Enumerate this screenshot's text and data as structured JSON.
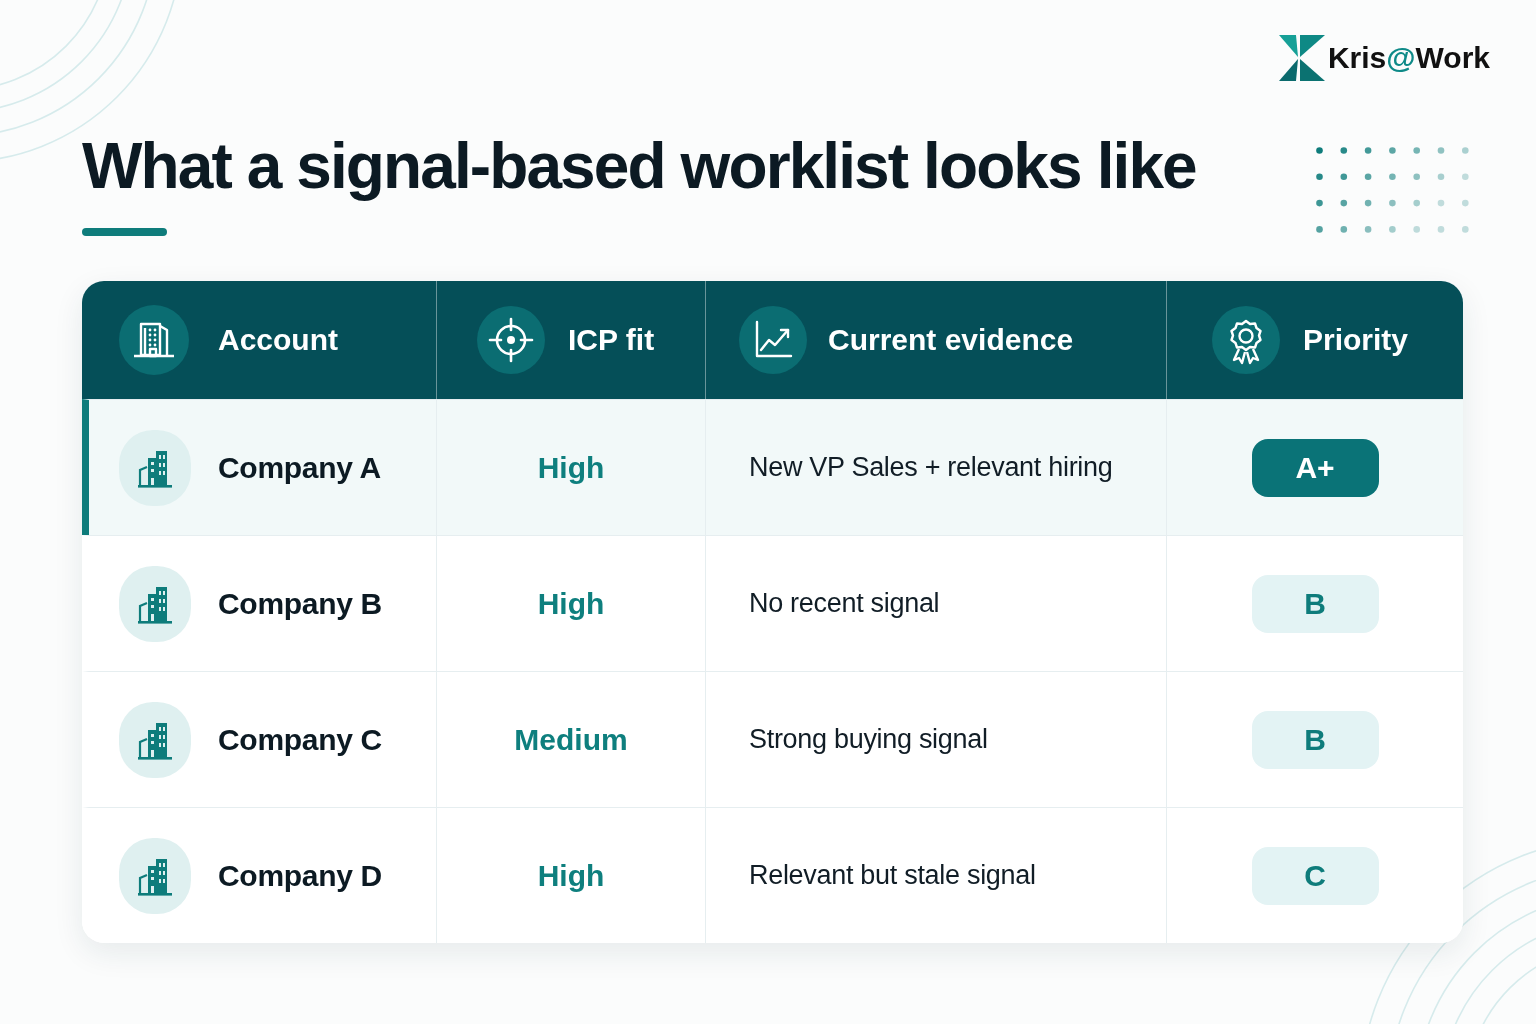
{
  "brand": {
    "wordmark": [
      {
        "text": "Kris",
        "accent": false
      },
      {
        "text": "@",
        "accent": true
      },
      {
        "text": "Work",
        "accent": false
      }
    ]
  },
  "title": "What a signal-based worklist looks like",
  "table": {
    "columns": [
      "Account",
      "ICP fit",
      "Current evidence",
      "Priority"
    ],
    "rows": [
      {
        "selected": true,
        "account": "Company A",
        "icp_fit": "High",
        "evidence": "New VP Sales + relevant hiring",
        "priority": {
          "label": "A+",
          "filled": true
        }
      },
      {
        "selected": false,
        "account": "Company B",
        "icp_fit": "High",
        "evidence": "No recent signal",
        "priority": {
          "label": "B",
          "filled": false
        }
      },
      {
        "selected": false,
        "account": "Company C",
        "icp_fit": "Medium",
        "evidence": "Strong buying signal",
        "priority": {
          "label": "B",
          "filled": false
        }
      },
      {
        "selected": false,
        "account": "Company D",
        "icp_fit": "High",
        "evidence": "Relevant but stale signal",
        "priority": {
          "label": "C",
          "filled": false
        }
      }
    ]
  }
}
